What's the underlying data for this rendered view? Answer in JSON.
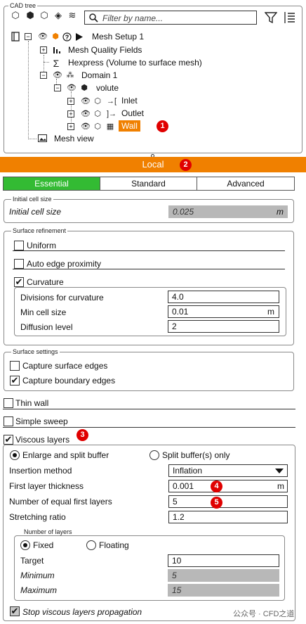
{
  "cad_tree": {
    "legend": "CAD tree",
    "filter_placeholder": "Filter by name...",
    "toolbar_icons": [
      "cube-outline-icon",
      "cubes-icon",
      "cubes-group-icon",
      "cube-wire-icon",
      "layers-icon"
    ],
    "items": {
      "mesh_setup": "Mesh Setup 1",
      "mesh_quality": "Mesh Quality Fields",
      "hexpress": "Hexpress (Volume to surface mesh)",
      "domain": "Domain 1",
      "volute": "volute",
      "inlet": "Inlet",
      "outlet": "Outlet",
      "wall": "Wall",
      "mesh_view": "Mesh view"
    }
  },
  "badges": {
    "b1": "1",
    "b2": "2",
    "b3": "3",
    "b4": "4",
    "b5": "5"
  },
  "local": {
    "title": "Local"
  },
  "tabs": {
    "essential": "Essential",
    "standard": "Standard",
    "advanced": "Advanced"
  },
  "initial_cell": {
    "legend": "Initial cell size",
    "label": "Initial cell size",
    "value": "0.025",
    "unit": "m"
  },
  "surface_refinement": {
    "legend": "Surface refinement",
    "uniform": "Uniform",
    "auto_edge": "Auto edge proximity",
    "curvature": "Curvature",
    "divisions_label": "Divisions for curvature",
    "divisions_value": "4.0",
    "min_cell_label": "Min cell size",
    "min_cell_value": "0.01",
    "min_cell_unit": "m",
    "diffusion_label": "Diffusion level",
    "diffusion_value": "2"
  },
  "surface_settings": {
    "legend": "Surface settings",
    "capture_surface": "Capture surface edges",
    "capture_boundary": "Capture boundary edges"
  },
  "thin_wall": "Thin wall",
  "simple_sweep": "Simple sweep",
  "viscous": {
    "label": "Viscous layers",
    "enlarge": "Enlarge and split buffer",
    "split_only": "Split buffer(s) only",
    "insertion_label": "Insertion method",
    "insertion_value": "Inflation",
    "first_thickness_label": "First layer thickness",
    "first_thickness_value": "0.001",
    "first_thickness_unit": "m",
    "equal_first_label": "Number of equal first layers",
    "equal_first_value": "5",
    "stretching_label": "Stretching ratio",
    "stretching_value": "1.2",
    "num_layers_legend": "Number of layers",
    "fixed": "Fixed",
    "floating": "Floating",
    "target_label": "Target",
    "target_value": "10",
    "minimum_label": "Minimum",
    "minimum_value": "5",
    "maximum_label": "Maximum",
    "maximum_value": "15",
    "stop_label": "Stop viscous layers propagation"
  },
  "watermark": "公众号 · CFD之道",
  "colors": {
    "accent_orange": "#f08000",
    "active_tab": "#33bb33",
    "badge_red": "#e00000"
  }
}
